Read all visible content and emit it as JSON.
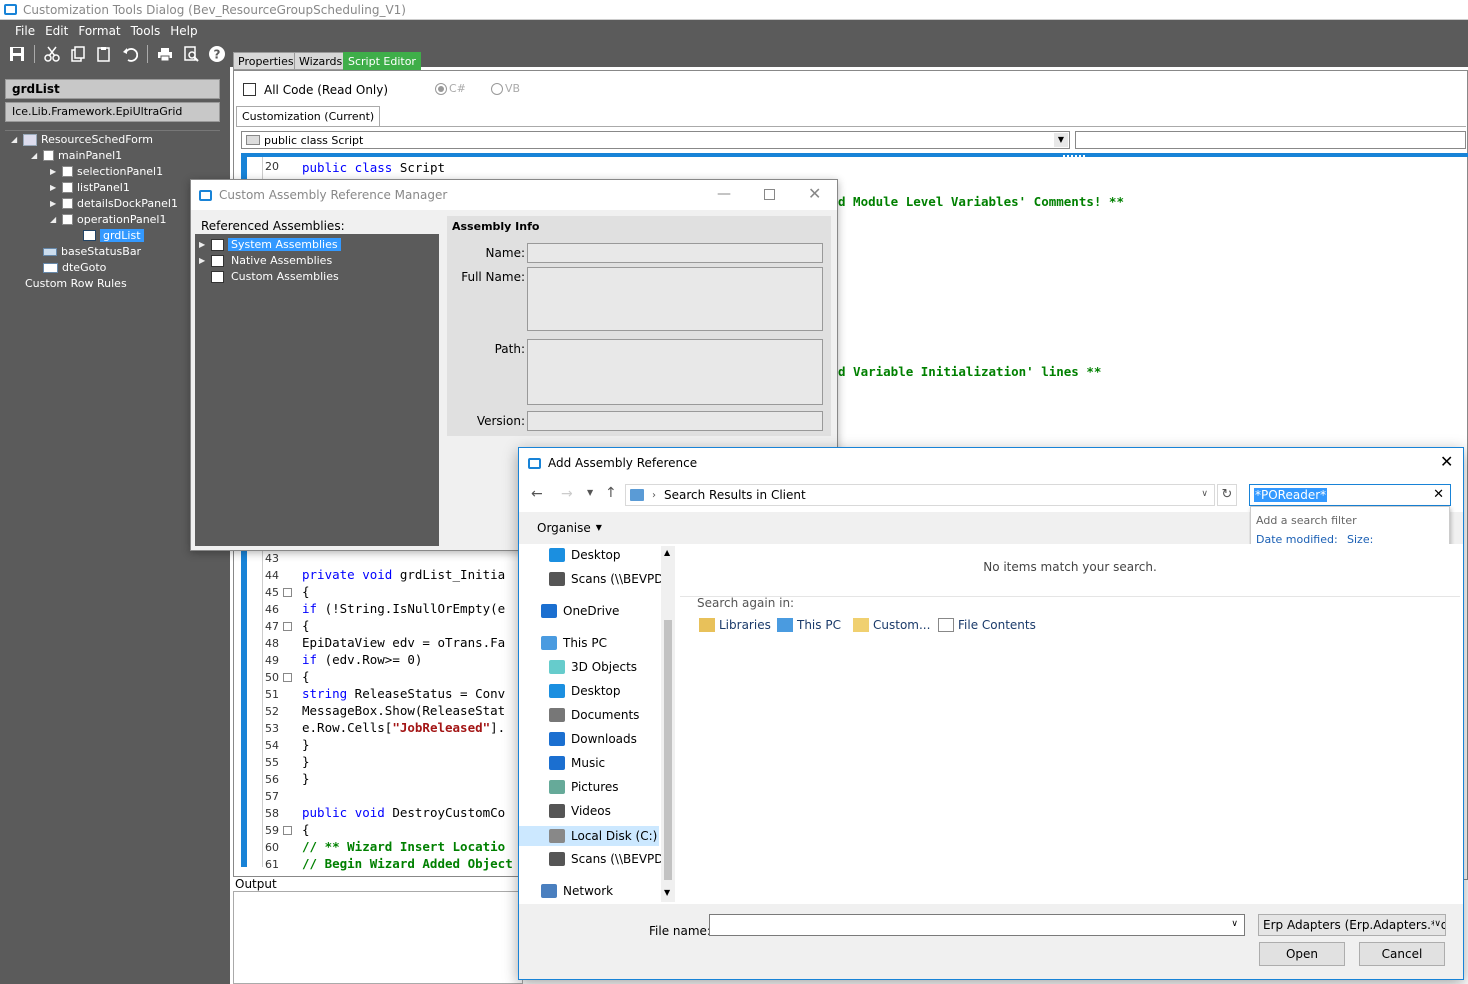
{
  "window": {
    "title": "Customization Tools Dialog  (Bev_ResourceGroupScheduling_V1)"
  },
  "menu": [
    "File",
    "Edit",
    "Format",
    "Tools",
    "Help"
  ],
  "left": {
    "selected_control": "grdList",
    "control_type": "Ice.Lib.Framework.EpiUltraGrid",
    "tree": {
      "root": "ResourceSchedForm",
      "mainPanel": "mainPanel1",
      "children": [
        "selectionPanel1",
        "listPanel1",
        "detailsDockPanel1",
        "operationPanel1"
      ],
      "grid": "grdList",
      "statusbar": "baseStatusBar",
      "dte": "dteGoto",
      "rules": "Custom Row Rules"
    }
  },
  "tabs": {
    "properties": "Properties",
    "wizards": "Wizards",
    "script_editor": "Script Editor"
  },
  "editor": {
    "all_code": "All Code (Read Only)",
    "csharp": "C#",
    "vb": "VB",
    "subtab": "Customization (Current)",
    "class_dropdown": "public class Script",
    "output_label": "Output",
    "line20": {
      "num": "20",
      "kw": "public class",
      "rest": " Script"
    },
    "comment1": "d Module Level Variables' Comments! **",
    "comment2": "d Variable Initialization' lines **",
    "lines": [
      {
        "num": "43",
        "code": ""
      },
      {
        "num": "44",
        "code": "private void grdList_Initia"
      },
      {
        "num": "45",
        "code": "{"
      },
      {
        "num": "46",
        "code": "if (!String.IsNullOrEmpty(e"
      },
      {
        "num": "47",
        "code": "{"
      },
      {
        "num": "48",
        "code": "EpiDataView edv = oTrans.Fa"
      },
      {
        "num": "49",
        "code": "if (edv.Row>= 0)"
      },
      {
        "num": "50",
        "code": "{"
      },
      {
        "num": "51",
        "code": "string ReleaseStatus = Conv"
      },
      {
        "num": "52",
        "code": "MessageBox.Show(ReleaseStat"
      },
      {
        "num": "53",
        "code": "e.Row.Cells[\"JobReleased\"]."
      },
      {
        "num": "54",
        "code": "}"
      },
      {
        "num": "55",
        "code": "}"
      },
      {
        "num": "56",
        "code": "}"
      },
      {
        "num": "57",
        "code": ""
      },
      {
        "num": "58",
        "code": "public void DestroyCustomCo"
      },
      {
        "num": "59",
        "code": "{"
      },
      {
        "num": "60",
        "code": "// ** Wizard Insert Locatio"
      },
      {
        "num": "61",
        "code": "// Begin Wizard Added Object"
      }
    ]
  },
  "cam_dialog": {
    "title": "Custom Assembly Reference Manager",
    "referenced_label": "Referenced Assemblies:",
    "items": [
      "System Assemblies",
      "Native Assemblies",
      "Custom Assemblies"
    ],
    "info_title": "Assembly Info",
    "name_label": "Name:",
    "fullname_label": "Full Name:",
    "path_label": "Path:",
    "version_label": "Version:"
  },
  "aar_dialog": {
    "title": "Add Assembly Reference",
    "breadcrumb": "Search Results in Client",
    "search_value": "*POReader*",
    "filter_hint": "Add a search filter",
    "filter_date": "Date modified:",
    "filter_size": "Size:",
    "organise": "Organise",
    "no_items": "No items match your search.",
    "search_again": "Search again in:",
    "search_locations": [
      "Libraries",
      "This PC",
      "Custom...",
      "File Contents"
    ],
    "nav": [
      "Desktop",
      "Scans (\\\\BEVPDC",
      "OneDrive",
      "This PC",
      "3D Objects",
      "Desktop",
      "Documents",
      "Downloads",
      "Music",
      "Pictures",
      "Videos",
      "Local Disk (C:)",
      "Scans (\\\\BEVPDC",
      "Network"
    ],
    "filename_label": "File name:",
    "filetype": "Erp Adapters (Erp.Adapters.*.dll",
    "open": "Open",
    "cancel": "Cancel"
  },
  "colors": {
    "accent": "#1883d7",
    "dark_panel": "#5b5b5b",
    "script_tab": "#3fae49",
    "selection": "#3399ff"
  }
}
